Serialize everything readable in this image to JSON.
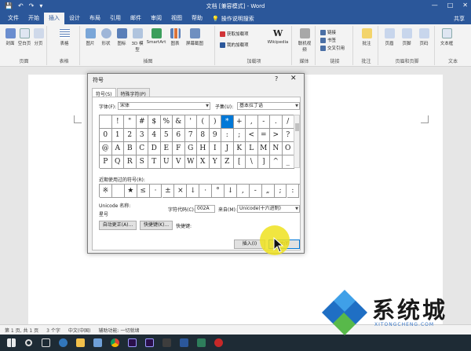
{
  "titlebar": {
    "title": "文档 [兼容模式] - Word",
    "qat": [
      "💾",
      "↶",
      "↷",
      "▾"
    ],
    "controls": [
      "—",
      "□",
      "✕"
    ]
  },
  "tabs": [
    "文件",
    "开始",
    "插入",
    "设计",
    "布局",
    "引用",
    "邮件",
    "审阅",
    "视图",
    "帮助"
  ],
  "tellme": "操作说明搜索",
  "share": "共享",
  "ribbon": {
    "groups": [
      {
        "label": "页面",
        "buttons": [
          "封面",
          "空白页",
          "分页"
        ]
      },
      {
        "label": "表格",
        "buttons": [
          "表格"
        ]
      },
      {
        "label": "插图",
        "buttons": [
          "图片",
          "形状",
          "图标",
          "3D 模型",
          "SmartArt",
          "图表",
          "屏幕截图"
        ]
      },
      {
        "label": "加载项",
        "small": [
          "获取加载项",
          "我的加载项"
        ],
        "buttons": [
          "Wikipedia"
        ]
      },
      {
        "label": "媒体",
        "buttons": [
          "联机视频"
        ]
      },
      {
        "label": "链接",
        "small": [
          "链接",
          "书签",
          "交叉引用"
        ]
      },
      {
        "label": "批注",
        "buttons": [
          "批注"
        ]
      },
      {
        "label": "页眉和页脚",
        "buttons": [
          "页眉",
          "页脚",
          "页码"
        ]
      },
      {
        "label": "文本",
        "buttons": [
          "文本框"
        ]
      }
    ]
  },
  "dialog": {
    "title": "符号",
    "help": "?",
    "close": "✕",
    "tabs": [
      "符号(S)",
      "特殊字符(P)"
    ],
    "font_label": "字体(F):",
    "font_value": "宋体",
    "subset_label": "子集(U):",
    "subset_value": "基本拉丁语",
    "symbols": [
      "!",
      "\"",
      "#",
      "$",
      "%",
      "&",
      "'",
      "(",
      ")",
      "*",
      "+",
      ",",
      "-",
      ".",
      "/",
      "0",
      "1",
      "2",
      "3",
      "4",
      "5",
      "6",
      "7",
      "8",
      "9",
      ":",
      ";",
      "<",
      "=",
      ">",
      "?",
      "@",
      "A",
      "B",
      "C",
      "D",
      "E",
      "F",
      "G",
      "H",
      "I",
      "J",
      "K",
      "L",
      "M",
      "N",
      "O",
      "P",
      "Q",
      "R",
      "S",
      "T",
      "U",
      "V",
      "W",
      "X",
      "Y",
      "Z",
      "[",
      "\\",
      "]",
      "^",
      "_"
    ],
    "selected_symbol": "*",
    "recent_label": "近期使用过的符号(R):",
    "recent": [
      "※",
      "",
      "★",
      "≤",
      "·",
      "±",
      "×",
      "↓",
      "·",
      "°",
      "↓",
      "‚",
      "-",
      "„",
      ";",
      ":"
    ],
    "unicode_label": "Unicode 名称:",
    "unicode_name": "星号",
    "code_label": "字符代码(C):",
    "code_value": "002A",
    "from_label": "来自(M):",
    "from_value": "Unicode(十六进制)",
    "autocorrect": "自动更正(A)...",
    "shortcut_btn": "快捷键(K)...",
    "shortcut_label": "快捷键:",
    "insert": "插入(I)",
    "close_btn": "关闭"
  },
  "statusbar": [
    "第 1 页, 共 1 页",
    "3 个字",
    "中文(中国)",
    "辅助功能: 一切就绪"
  ],
  "watermark": {
    "text": "系统城",
    "sub": "XITONGCHENG.COM"
  },
  "colors": {
    "word_blue": "#2b579a",
    "select_blue": "#0078d7",
    "highlight": "#eee21e"
  }
}
